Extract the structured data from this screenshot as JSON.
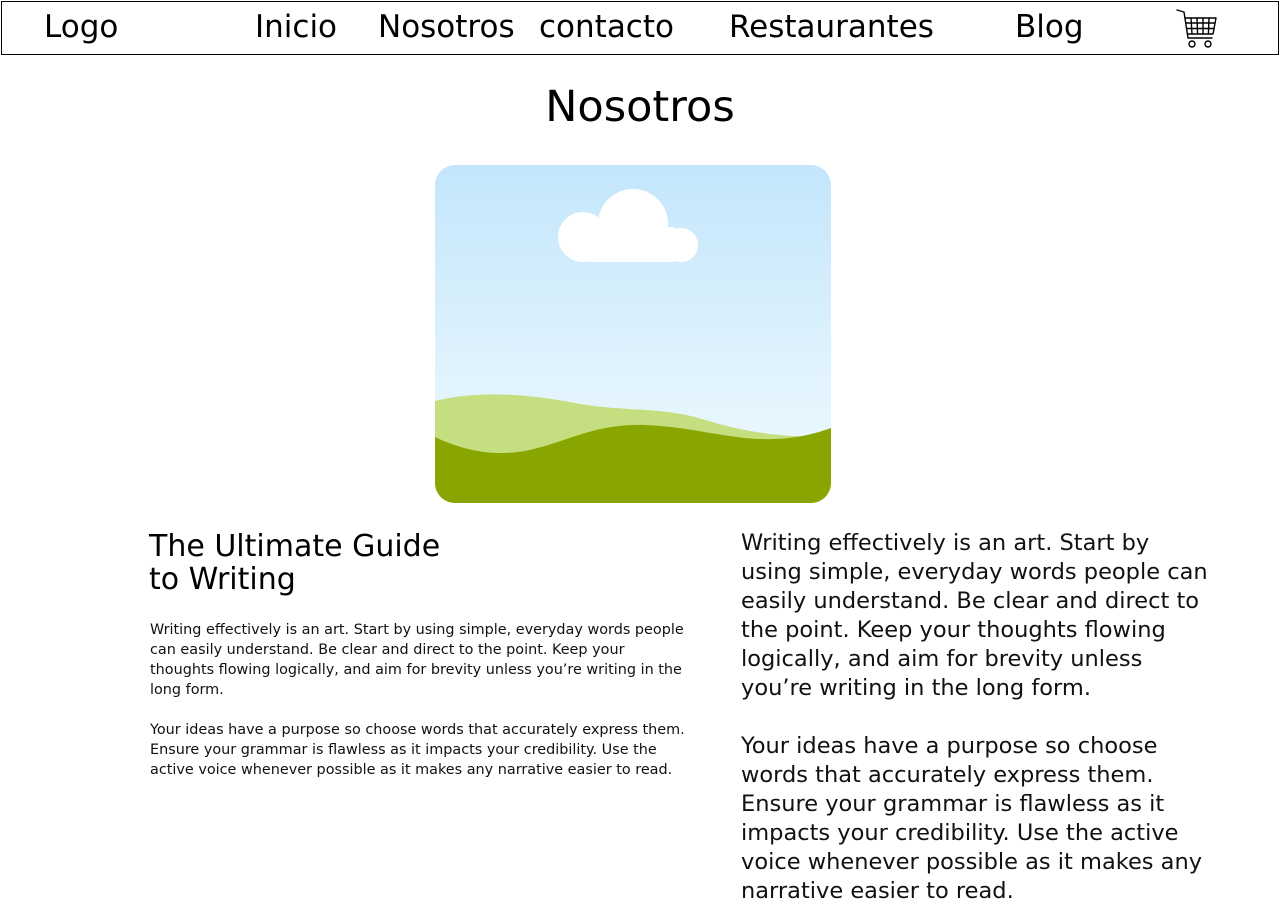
{
  "nav": {
    "logo": "Logo",
    "items": [
      {
        "label": "Inicio"
      },
      {
        "label": "Nosotros"
      },
      {
        "label": "contacto"
      },
      {
        "label": "Restaurantes"
      },
      {
        "label": "Blog"
      }
    ],
    "cart_icon": "shopping-cart-icon"
  },
  "page": {
    "title": "Nosotros"
  },
  "hero": {
    "icon": "landscape-placeholder-image",
    "colors": {
      "sky_top": "#c3e6fb",
      "sky_bottom": "#eef9fe",
      "cloud": "#ffffff",
      "hill_back": "#c5df80",
      "hill_front": "#89a600"
    }
  },
  "article": {
    "title_line1": "The Ultimate Guide",
    "title_line2": "to Writing",
    "paragraph1": "Writing effectively is an art. Start by using simple, everyday words people can easily understand. Be clear and direct to the point. Keep your thoughts flowing logically, and aim for brevity unless you’re writing in the long form.",
    "paragraph2": "Your ideas have a purpose so choose words that accurately express them. Ensure your grammar is flawless as it impacts your credibility. Use the active voice whenever possible as it makes any narrative easier to read."
  }
}
